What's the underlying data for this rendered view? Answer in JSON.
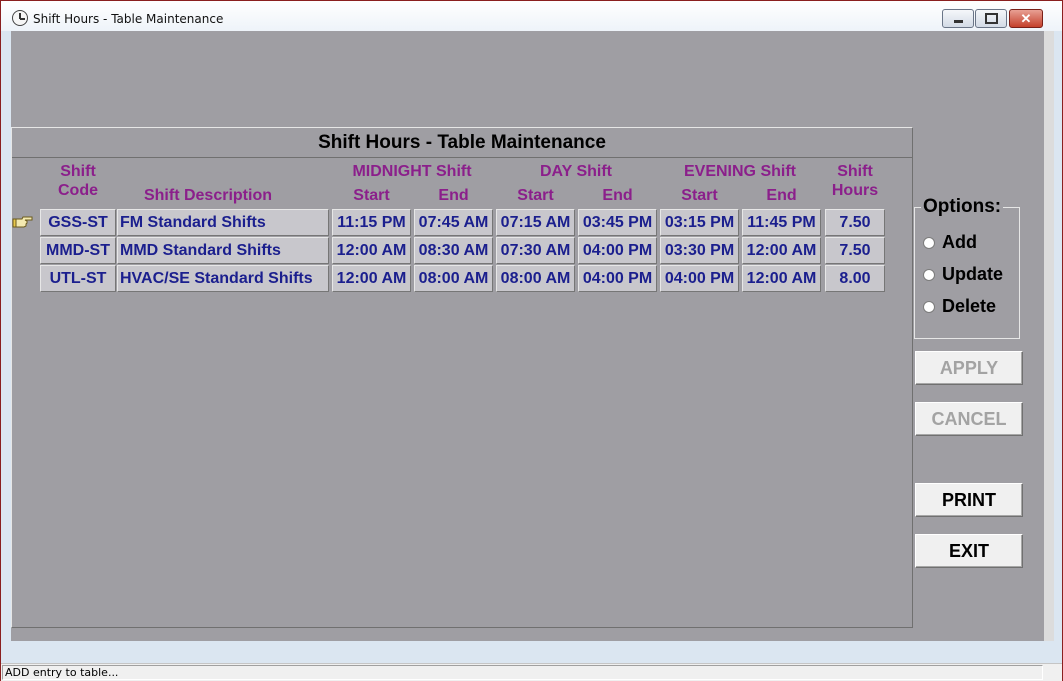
{
  "window": {
    "title": "Shift Hours - Table Maintenance"
  },
  "panel": {
    "title": "Shift Hours - Table Maintenance",
    "headers": {
      "shift_code_line1": "Shift",
      "shift_code_line2": "Code",
      "shift_description": "Shift Description",
      "midnight_shift": "MIDNIGHT Shift",
      "day_shift": "DAY Shift",
      "evening_shift": "EVENING Shift",
      "start": "Start",
      "end": "End",
      "shift_hours_line1": "Shift",
      "shift_hours_line2": "Hours"
    },
    "rows": [
      {
        "code": "GSS-ST",
        "description": "FM Standard Shifts",
        "midnight_start": "11:15 PM",
        "midnight_end": "07:45 AM",
        "day_start": "07:15 AM",
        "day_end": "03:45 PM",
        "evening_start": "03:15 PM",
        "evening_end": "11:45 PM",
        "hours": "7.50"
      },
      {
        "code": "MMD-ST",
        "description": "MMD Standard Shifts",
        "midnight_start": "12:00 AM",
        "midnight_end": "08:30 AM",
        "day_start": "07:30 AM",
        "day_end": "04:00 PM",
        "evening_start": "03:30 PM",
        "evening_end": "12:00 AM",
        "hours": "7.50"
      },
      {
        "code": "UTL-ST",
        "description": "HVAC/SE Standard Shifts",
        "midnight_start": "12:00 AM",
        "midnight_end": "08:00 AM",
        "day_start": "08:00 AM",
        "day_end": "04:00 PM",
        "evening_start": "04:00 PM",
        "evening_end": "12:00 AM",
        "hours": "8.00"
      }
    ]
  },
  "options": {
    "legend": "Options:",
    "add": "Add",
    "update": "Update",
    "delete": "Delete"
  },
  "buttons": {
    "apply": "APPLY",
    "cancel": "CANCEL",
    "print": "PRINT",
    "exit": "EXIT"
  },
  "status": {
    "text": "ADD entry to table..."
  },
  "icons": {
    "window_icon": "clock-icon",
    "row_pointer": "pointing-hand-icon"
  },
  "colors": {
    "header_text": "#8b1f8b",
    "cell_text": "#1b1f8e",
    "background": "#9f9ea3"
  }
}
